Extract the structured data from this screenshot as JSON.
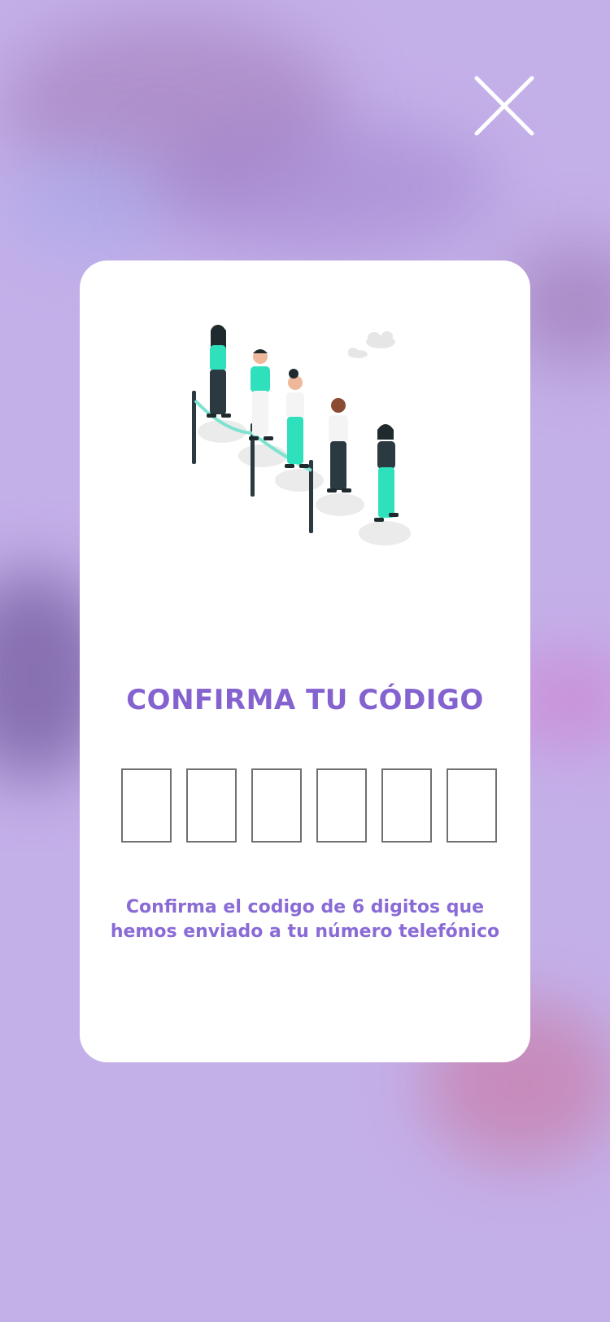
{
  "modal": {
    "title": "CONFIRMA TU CÓDIGO",
    "description": "Confirma el codigo de 6 digitos que hemos enviado a tu número telefónico",
    "code_length": 6,
    "code_values": [
      "",
      "",
      "",
      "",
      "",
      ""
    ]
  },
  "icons": {
    "close": "close-icon",
    "illustration": "people-in-queue-illustration"
  },
  "colors": {
    "accent": "#8462cf",
    "background": "#c4b0e9",
    "card": "#ffffff",
    "teal": "#2fe0bd",
    "dark": "#2b3a40"
  }
}
